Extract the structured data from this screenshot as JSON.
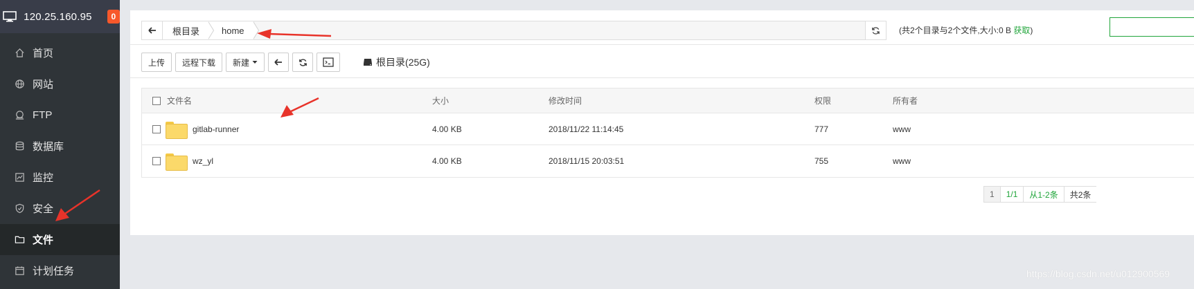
{
  "sidebar": {
    "ip": "120.25.160.95",
    "badge": "0",
    "items": [
      {
        "label": "首页",
        "icon": "home-icon"
      },
      {
        "label": "网站",
        "icon": "globe-icon"
      },
      {
        "label": "FTP",
        "icon": "ftp-icon"
      },
      {
        "label": "数据库",
        "icon": "database-icon"
      },
      {
        "label": "监控",
        "icon": "monitor-chart-icon"
      },
      {
        "label": "安全",
        "icon": "shield-icon"
      },
      {
        "label": "文件",
        "icon": "folder-icon",
        "active": true
      },
      {
        "label": "计划任务",
        "icon": "calendar-icon"
      }
    ]
  },
  "path": {
    "crumbs": [
      "根目录",
      "home"
    ],
    "info_prefix": "(共2个目录与2个文件,大小:",
    "info_size": "0 B",
    "info_link": "获取",
    "info_suffix": ")"
  },
  "toolbar": {
    "upload": "上传",
    "remote_download": "远程下载",
    "new": "新建",
    "disk_label": "根目录(25G)"
  },
  "table": {
    "headers": {
      "name": "文件名",
      "size": "大小",
      "mtime": "修改时间",
      "perm": "权限",
      "owner": "所有者"
    },
    "rows": [
      {
        "name": "gitlab-runner",
        "size": "4.00 KB",
        "mtime": "2018/11/22 11:14:45",
        "perm": "777",
        "owner": "www"
      },
      {
        "name": "wz_yl",
        "size": "4.00 KB",
        "mtime": "2018/11/15 20:03:51",
        "perm": "755",
        "owner": "www"
      }
    ]
  },
  "pager": {
    "current": "1",
    "pages": "1/1",
    "range": "从1-2条",
    "total": "共2条"
  },
  "watermark": "https://blog.csdn.net/u012900569",
  "colors": {
    "accent": "#20a53a",
    "sidebar_bg": "#2f3438",
    "badge": "#f7582b",
    "annotation_arrow": "#e8332a"
  }
}
